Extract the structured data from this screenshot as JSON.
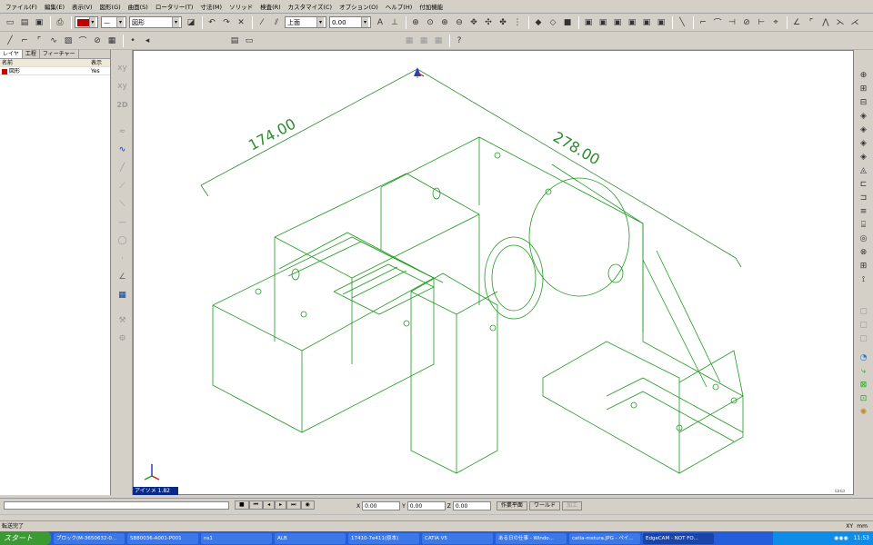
{
  "menu": [
    "ファイル(F)",
    "編集(E)",
    "表示(V)",
    "図形(G)",
    "曲面(S)",
    "ロータリー(T)",
    "寸法(M)",
    "ソリッド",
    "検査(R)",
    "カスタマイズ(C)",
    "オプション(O)",
    "ヘルプ(H)",
    "付加機能"
  ],
  "toolbar": {
    "layer_combo": "図形",
    "view_combo": "上面",
    "value_combo": "0.00"
  },
  "left_panel": {
    "tabs": [
      "レイヤ",
      "工程",
      "フィーチャー"
    ],
    "header": {
      "name": "名前",
      "display": "表示"
    },
    "rows": [
      {
        "name": "図形",
        "display": "Yes"
      }
    ]
  },
  "left_icons": {
    "label_2d": "2D"
  },
  "viewport": {
    "dim1": "174.00",
    "dim2": "278.00",
    "view_label": "アイソメ 1.82",
    "colors": {
      "wire": "#1f9a1f",
      "dim": "#2e8b2e"
    }
  },
  "coords": {
    "x_label": "X",
    "x": "0.00",
    "y_label": "Y",
    "y": "0.00",
    "z_label": "Z",
    "z": "0.00",
    "plane": "作業平面",
    "world": "ワールド",
    "apply": "加工"
  },
  "status": {
    "text": "転送完了",
    "units": "XY",
    "mm": "mm"
  },
  "taskbar": {
    "start": "スタート",
    "tasks": [
      "ブロック(M-3650632-0...",
      "SB80036-A001-P001",
      "ns1",
      "ALB",
      "17410-7e411(原本)",
      "CATIA V5",
      "ある日の仕事 - Windo...",
      "catia-mstura.JPG - ペイ...",
      "EdgeCAM - NOT FO..."
    ],
    "clock": "11:53"
  }
}
